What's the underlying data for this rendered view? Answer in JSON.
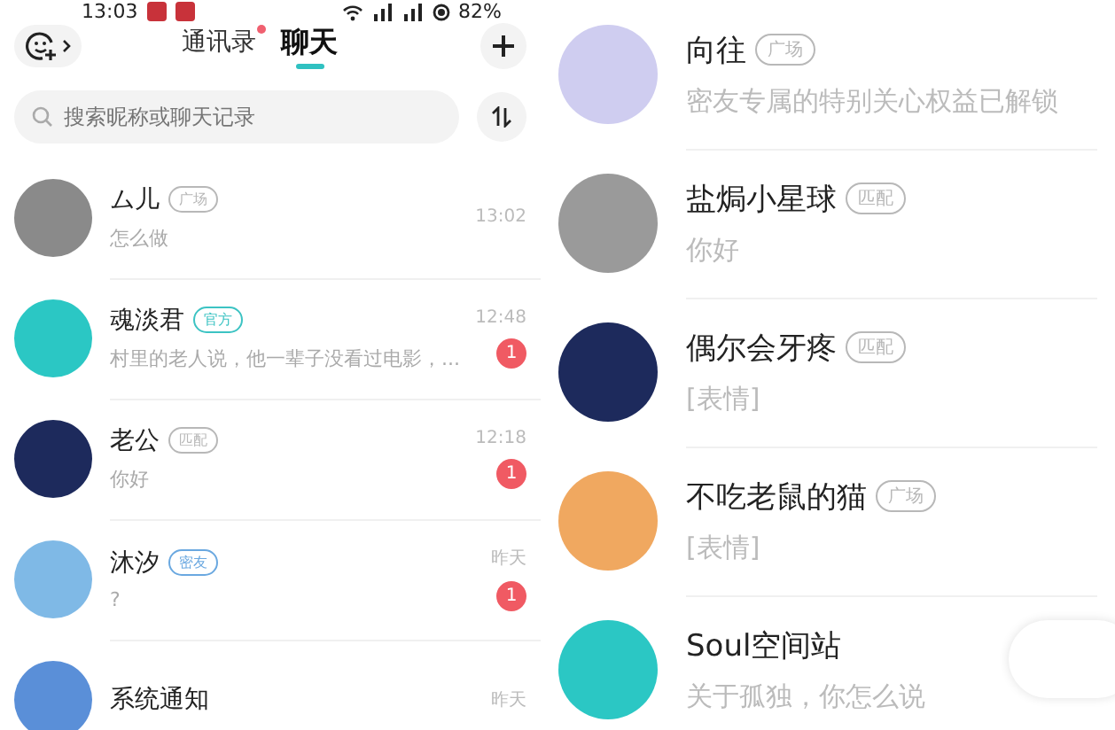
{
  "status_bar": {
    "time": "13:03",
    "battery": "82%"
  },
  "header": {
    "tabs": [
      {
        "label": "通讯录",
        "selected": false,
        "dot": true
      },
      {
        "label": "聊天",
        "selected": true,
        "dot": false
      }
    ]
  },
  "search": {
    "placeholder": "搜索昵称或聊天记录"
  },
  "left_chats": [
    {
      "name": "ム儿",
      "tag": {
        "text": "广场",
        "color": "#b8b8b8"
      },
      "preview": "怎么做",
      "time": "13:02",
      "color": "#8a8a8a"
    },
    {
      "name": "魂淡君",
      "tag": {
        "text": "官方",
        "color": "#3cc3c3"
      },
      "preview": "村里的老人说，他一辈子没看过电影，...",
      "time": "12:48",
      "unread": "1",
      "color": "#2bc7c4"
    },
    {
      "name": "老公",
      "tag": {
        "text": "匹配",
        "color": "#b8b8b8"
      },
      "preview": "你好",
      "time": "12:18",
      "unread": "1",
      "color": "#1d2a5c"
    },
    {
      "name": "沐汐",
      "tag": {
        "text": "密友",
        "color": "#6aa8e0"
      },
      "preview": "?",
      "time": "昨天",
      "unread": "1",
      "color": "#7fb9e6"
    },
    {
      "name": "系统通知",
      "time": "昨天",
      "color": "#5a8fd8"
    }
  ],
  "right_chats": [
    {
      "name": "向往",
      "tag": {
        "text": "广场",
        "color": "#b8b8b8"
      },
      "preview": "密友专属的特别关心权益已解锁",
      "color": "#cfcdf0"
    },
    {
      "name": "盐焗小星球",
      "tag": {
        "text": "匹配",
        "color": "#b8b8b8"
      },
      "preview": "你好",
      "color": "#9a9a9a"
    },
    {
      "name": "偶尔会牙疼",
      "tag": {
        "text": "匹配",
        "color": "#b8b8b8"
      },
      "preview": "[表情]",
      "color": "#1d2a5c"
    },
    {
      "name": "不吃老鼠的猫",
      "tag": {
        "text": "广场",
        "color": "#b8b8b8"
      },
      "preview": "[表情]",
      "color": "#f0a860"
    },
    {
      "name": "Soul空间站",
      "preview": "关于孤独，你怎么说",
      "color": "#2bc7c4"
    }
  ]
}
